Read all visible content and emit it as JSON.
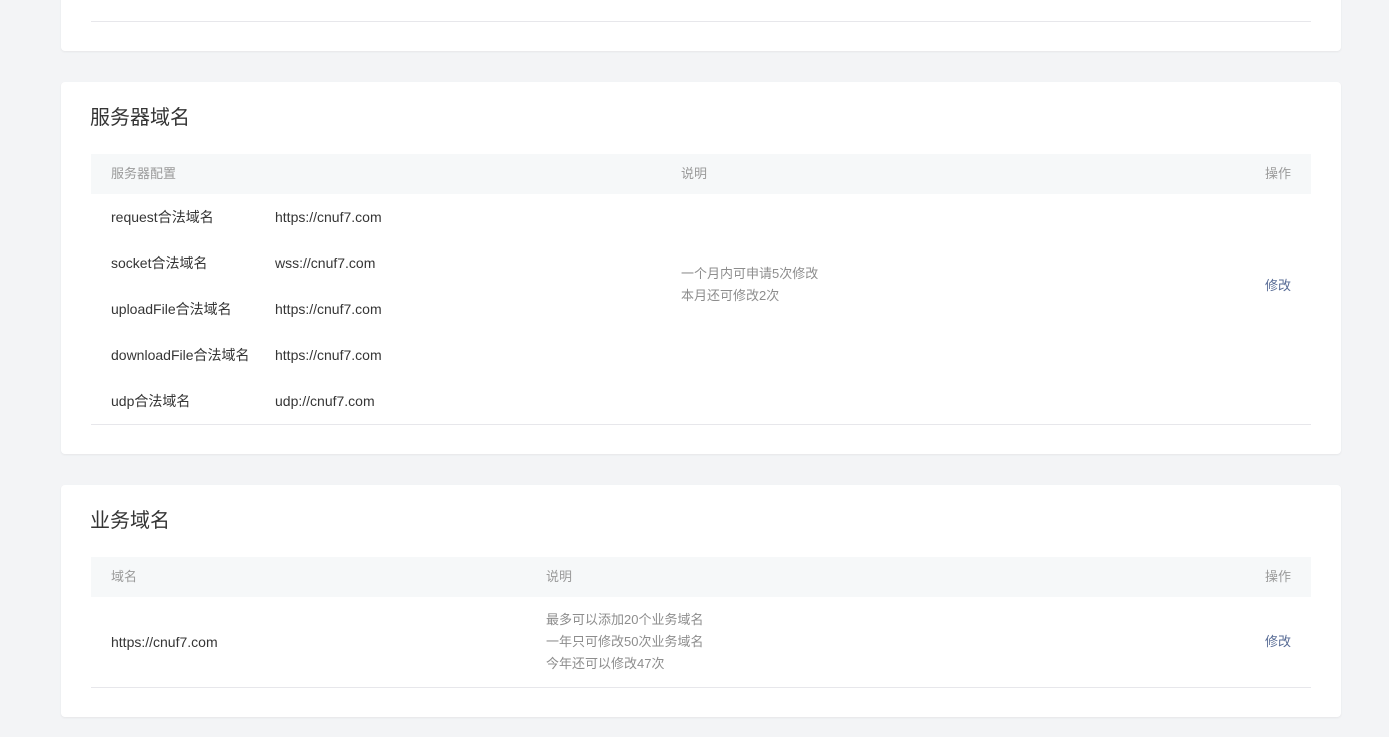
{
  "server_domain": {
    "title": "服务器域名",
    "headers": {
      "config": "服务器配置",
      "desc": "说明",
      "action": "操作"
    },
    "rows": [
      {
        "name": "request合法域名",
        "value": "https://cnuf7.com"
      },
      {
        "name": "socket合法域名",
        "value": "wss://cnuf7.com"
      },
      {
        "name": "uploadFile合法域名",
        "value": "https://cnuf7.com"
      },
      {
        "name": "downloadFile合法域名",
        "value": "https://cnuf7.com"
      },
      {
        "name": "udp合法域名",
        "value": "udp://cnuf7.com"
      }
    ],
    "desc_lines": [
      "一个月内可申请5次修改",
      "本月还可修改2次"
    ],
    "action_label": "修改"
  },
  "business_domain": {
    "title": "业务域名",
    "headers": {
      "domain": "域名",
      "desc": "说明",
      "action": "操作"
    },
    "domain": "https://cnuf7.com",
    "desc_lines": [
      "最多可以添加20个业务域名",
      "一年只可修改50次业务域名",
      "今年还可以修改47次"
    ],
    "action_label": "修改"
  }
}
